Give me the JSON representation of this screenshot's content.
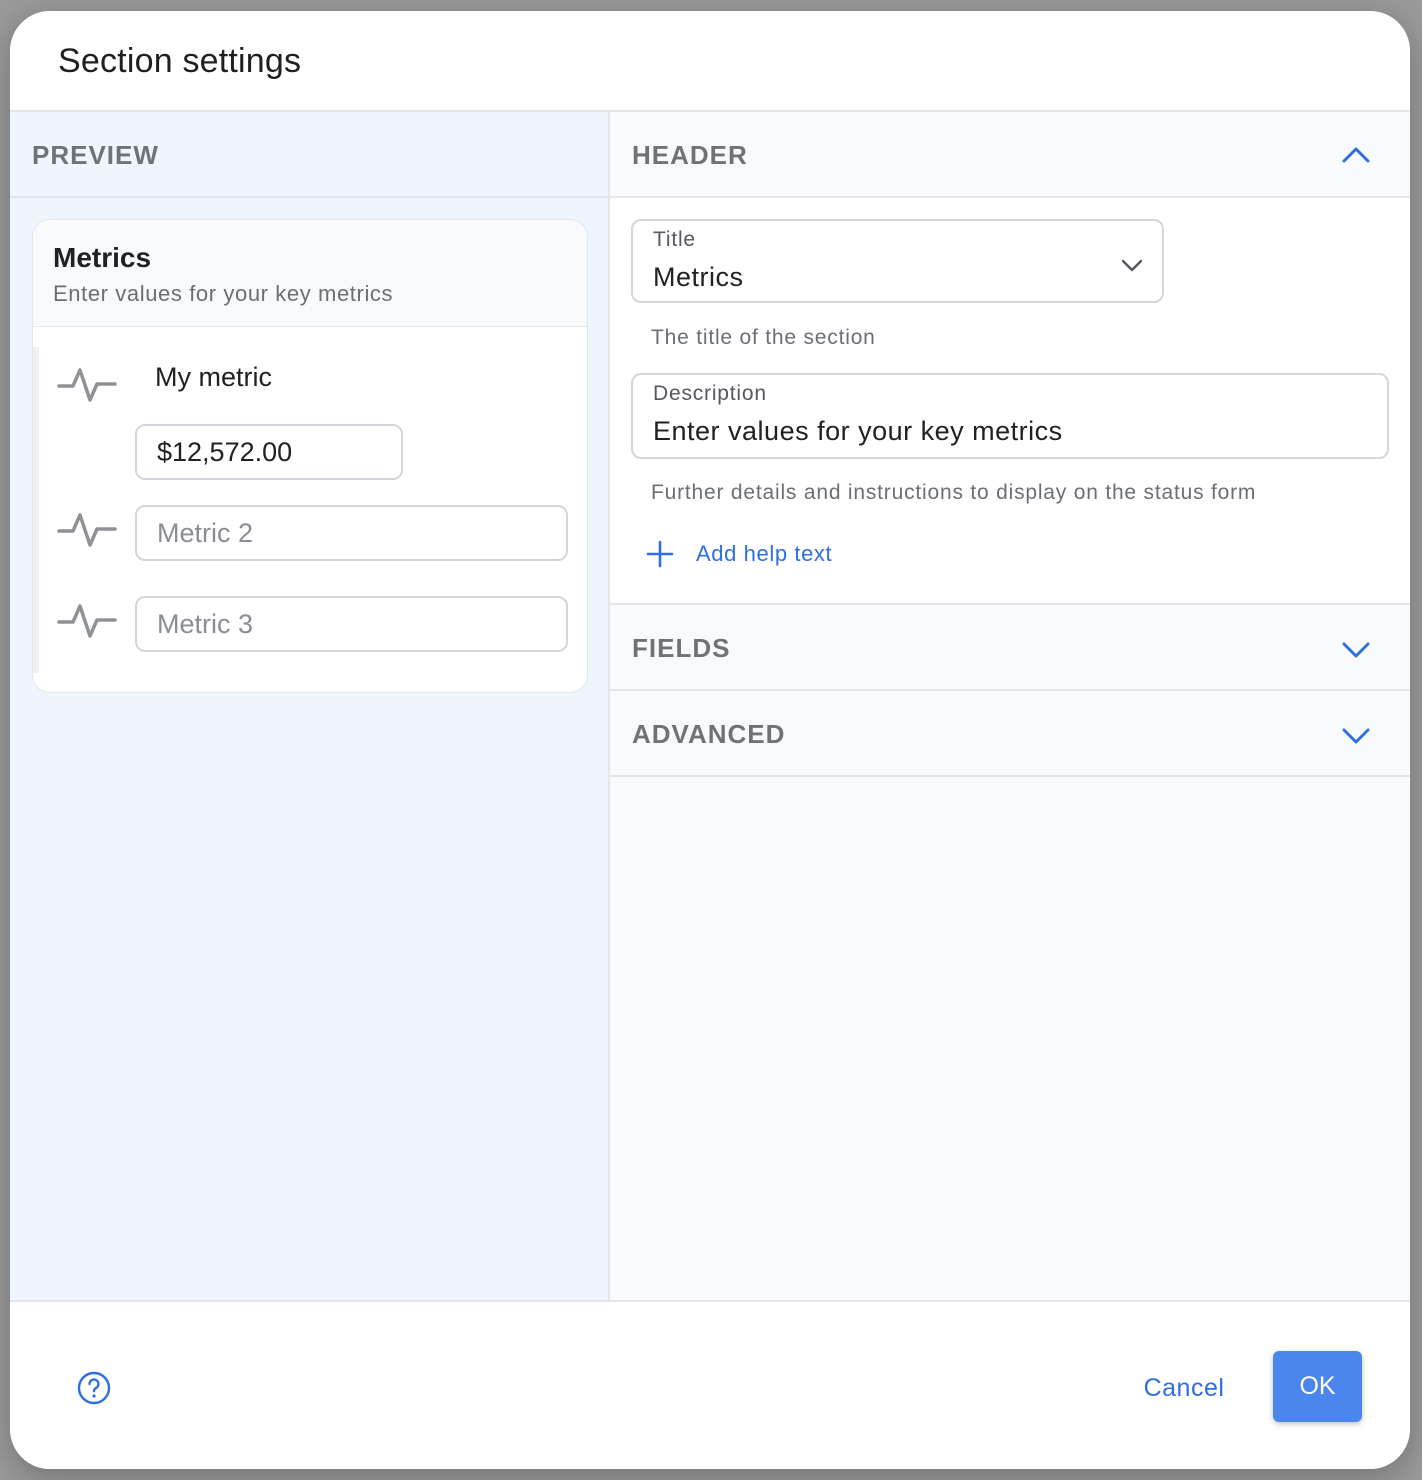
{
  "dialog": {
    "title": "Section settings"
  },
  "preview": {
    "section_label": "PREVIEW",
    "card": {
      "title": "Metrics",
      "description": "Enter values for your key metrics"
    },
    "metrics": [
      {
        "icon": "activity-icon",
        "label": "My metric",
        "value": "$12,572.00",
        "placeholder": ""
      },
      {
        "icon": "activity-icon",
        "label": "",
        "value": "",
        "placeholder": "Metric 2"
      },
      {
        "icon": "activity-icon",
        "label": "",
        "value": "",
        "placeholder": "Metric 3"
      }
    ]
  },
  "settings": {
    "header": {
      "label": "HEADER",
      "expanded": true,
      "icon": "chevron-up-icon",
      "title_field": {
        "label": "Title",
        "value": "Metrics",
        "icon": "chevron-down-icon",
        "helper": "The title of the section"
      },
      "description_field": {
        "label": "Description",
        "value": "Enter values for your key metrics",
        "helper": "Further details and instructions to display on the status form"
      },
      "add_help": {
        "label": "Add help text",
        "icon": "plus-icon"
      }
    },
    "fields": {
      "label": "FIELDS",
      "expanded": false,
      "icon": "chevron-down-icon"
    },
    "advanced": {
      "label": "ADVANCED",
      "expanded": false,
      "icon": "chevron-down-icon"
    }
  },
  "footer": {
    "help_icon": "help-circle-icon",
    "cancel_label": "Cancel",
    "ok_label": "OK"
  },
  "colors": {
    "accent": "#2f6fde",
    "ok_button": "#4a86ee",
    "preview_bg": "#eef5fd",
    "muted_text": "#6f7378",
    "icon_gray": "#8e9196"
  }
}
